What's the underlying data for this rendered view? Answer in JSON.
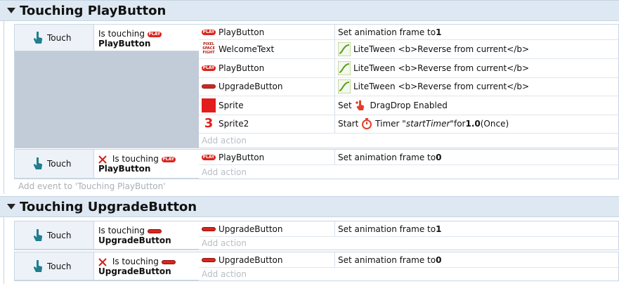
{
  "groups": [
    {
      "title": "Touching PlayButton",
      "add_event": "Add event to 'Touching PlayButton'",
      "events": [
        {
          "trigger": "Touch",
          "cond_prefix": "Is touching",
          "cond_object": "PlayButton",
          "negated": false,
          "actions": [
            {
              "object": "PlayButton",
              "icon": "play-button-icon",
              "action": "Set animation frame to ",
              "value": "1"
            },
            {
              "object": "WelcomeText",
              "icon": "welcome-text-icon",
              "action": "LiteTween <b>Reverse from current</b>"
            },
            {
              "object": "PlayButton",
              "icon": "play-button-icon",
              "action": "LiteTween <b>Reverse from current</b>"
            },
            {
              "object": "UpgradeButton",
              "icon": "upgrade-button-icon",
              "action": "LiteTween <b>Reverse from current</b>"
            },
            {
              "object": "Sprite",
              "icon": "sprite-icon",
              "action_pre": "Set",
              "action_post": "DragDrop Enabled"
            },
            {
              "object": "Sprite2",
              "icon": "sprite2-icon",
              "action_pre": "Start",
              "action_mid": "Timer",
              "tag": "\"startTimer\"",
              "for": " for ",
              "value": "1.0",
              "tail": " (Once)"
            }
          ],
          "add_action": "Add action"
        },
        {
          "trigger": "Touch",
          "cond_prefix": "Is touching",
          "cond_object": "PlayButton",
          "negated": true,
          "actions": [
            {
              "object": "PlayButton",
              "icon": "play-button-icon",
              "action": "Set animation frame to ",
              "value": "0"
            }
          ],
          "add_action": "Add action"
        }
      ]
    },
    {
      "title": "Touching UpgradeButton",
      "events": [
        {
          "trigger": "Touch",
          "cond_prefix": "Is touching",
          "cond_object": "UpgradeButton",
          "negated": false,
          "actions": [
            {
              "object": "UpgradeButton",
              "icon": "upgrade-button-icon",
              "action": "Set animation frame to ",
              "value": "1"
            }
          ],
          "add_action": "Add action"
        },
        {
          "trigger": "Touch",
          "cond_prefix": "Is touching",
          "cond_object": "UpgradeButton",
          "negated": true,
          "actions": [
            {
              "object": "UpgradeButton",
              "icon": "upgrade-button-icon",
              "action": "Set animation frame to ",
              "value": "0"
            }
          ],
          "add_action": "Add action"
        }
      ]
    }
  ],
  "icon_text": {
    "play": "PLAY",
    "welcome": "PIXEL SPACE FIGHT",
    "sprite2": "3"
  },
  "colors": {
    "header_bg": "#dde8f2",
    "accent_red": "#d8261e",
    "condition_fill": "#c2cbd8"
  }
}
